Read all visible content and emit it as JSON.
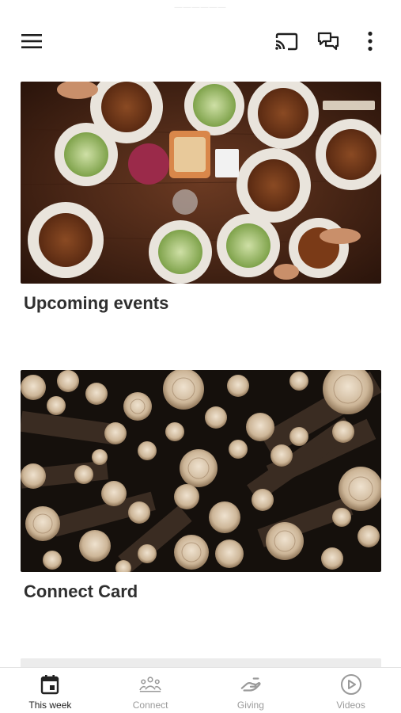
{
  "status_bar": {
    "hint": "——————"
  },
  "header": {
    "icons": [
      "hamburger-menu-icon",
      "cast-icon",
      "chat-icon",
      "more-vertical-icon"
    ]
  },
  "cards": [
    {
      "title": "Upcoming events",
      "image": "dinner-table-photo"
    },
    {
      "title": "Connect Card",
      "image": "cut-logs-photo"
    }
  ],
  "bottom_nav": {
    "items": [
      {
        "label": "This week",
        "icon": "calendar-icon",
        "active": true
      },
      {
        "label": "Connect",
        "icon": "group-icon",
        "active": false
      },
      {
        "label": "Giving",
        "icon": "giving-hand-icon",
        "active": false
      },
      {
        "label": "Videos",
        "icon": "play-circle-icon",
        "active": false
      }
    ]
  },
  "colors": {
    "active_nav": "#222222",
    "inactive_nav": "#9a9a9a",
    "text": "#2f2f2f",
    "divider": "#e2e2e2"
  }
}
